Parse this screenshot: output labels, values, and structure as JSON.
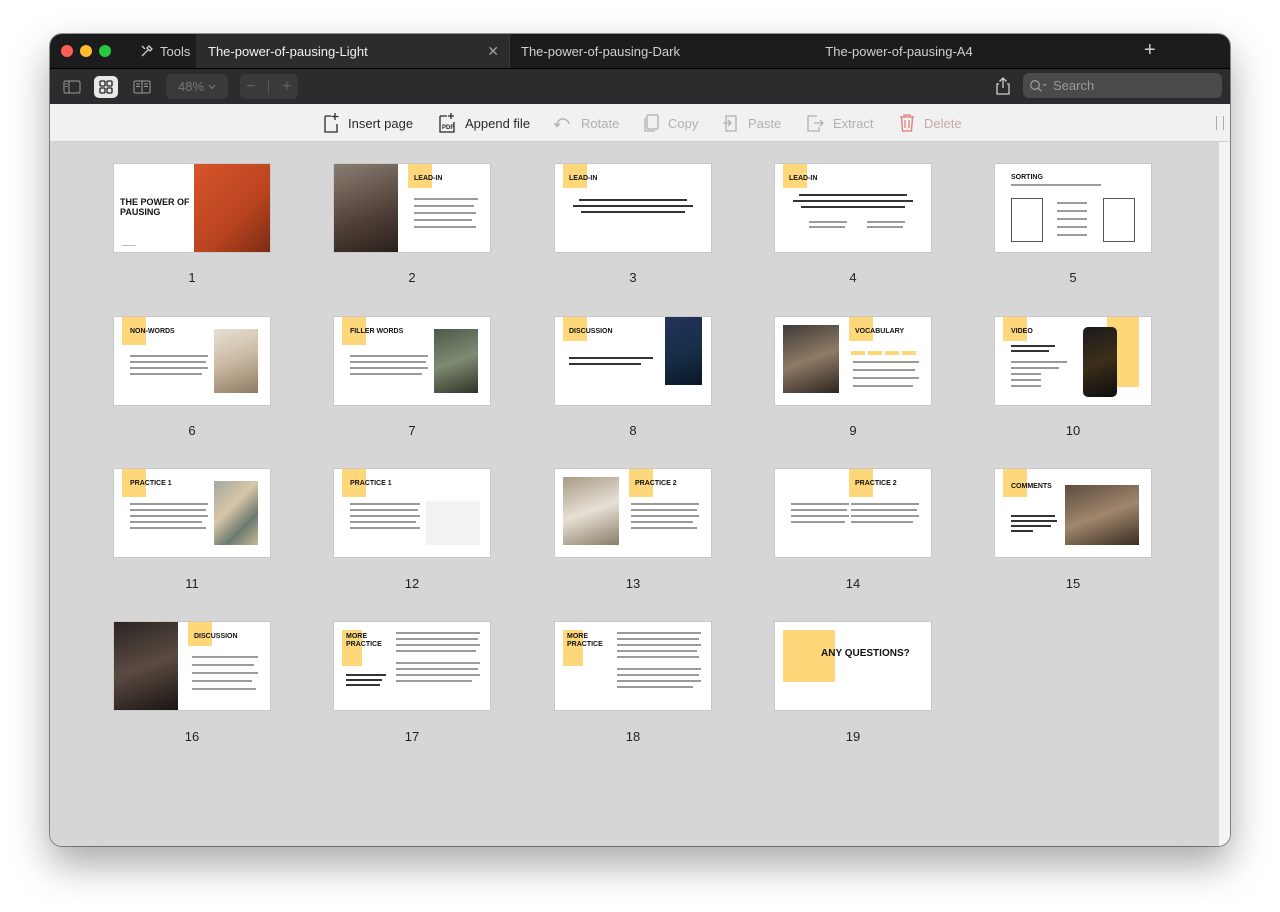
{
  "tabs": {
    "tools_label": "Tools",
    "active": "The-power-of-pausing-Light",
    "second": "The-power-of-pausing-Dark",
    "third": "The-power-of-pausing-A4"
  },
  "toolbar": {
    "zoom": "48%",
    "search_placeholder": "Search"
  },
  "actions": {
    "insert_page": "Insert page",
    "append_file": "Append file",
    "rotate": "Rotate",
    "copy": "Copy",
    "paste": "Paste",
    "extract": "Extract",
    "delete": "Delete"
  },
  "pages": [
    {
      "num": "1",
      "title": "THE POWER OF PAUSING"
    },
    {
      "num": "2",
      "title": "LEAD-IN"
    },
    {
      "num": "3",
      "title": "LEAD-IN"
    },
    {
      "num": "4",
      "title": "LEAD-IN"
    },
    {
      "num": "5",
      "title": "SORTING"
    },
    {
      "num": "6",
      "title": "NON-WORDS"
    },
    {
      "num": "7",
      "title": "FILLER WORDS"
    },
    {
      "num": "8",
      "title": "DISCUSSION"
    },
    {
      "num": "9",
      "title": "VOCABULARY"
    },
    {
      "num": "10",
      "title": "VIDEO"
    },
    {
      "num": "11",
      "title": "PRACTICE 1"
    },
    {
      "num": "12",
      "title": "PRACTICE 1"
    },
    {
      "num": "13",
      "title": "PRACTICE 2"
    },
    {
      "num": "14",
      "title": "PRACTICE 2"
    },
    {
      "num": "15",
      "title": "COMMENTS"
    },
    {
      "num": "16",
      "title": "DISCUSSION"
    },
    {
      "num": "17",
      "title": "MORE PRACTICE"
    },
    {
      "num": "18",
      "title": "MORE PRACTICE"
    },
    {
      "num": "19",
      "title": "ANY QUESTIONS?"
    }
  ],
  "colors": {
    "accent_yellow": "#fdd779",
    "delete_red": "#e07a7a"
  }
}
